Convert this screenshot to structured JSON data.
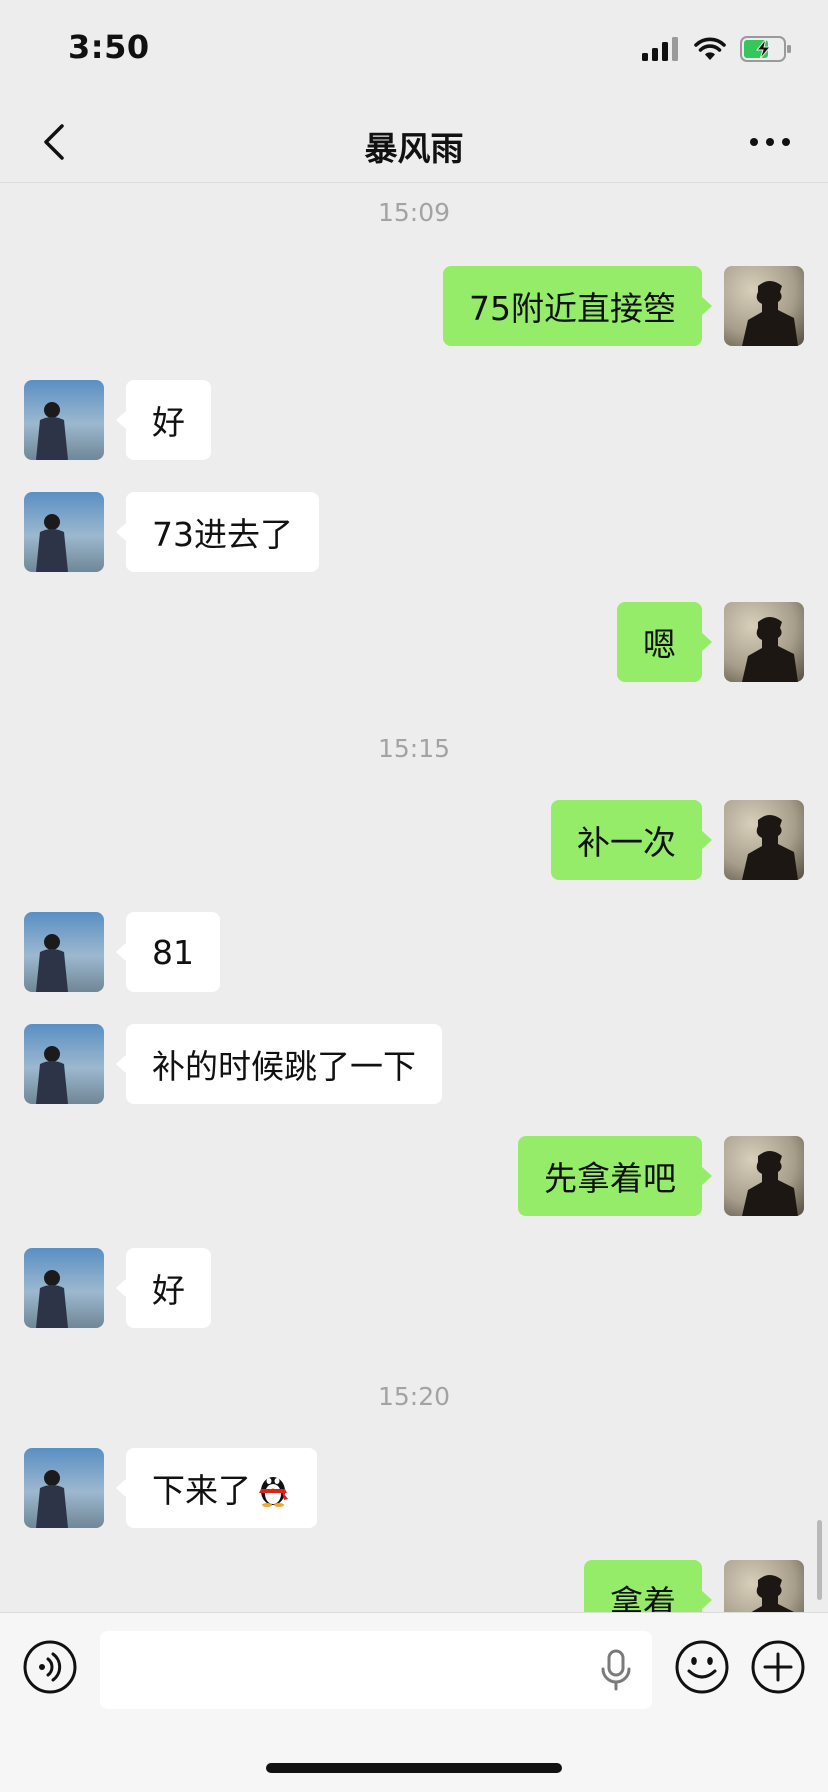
{
  "status_bar": {
    "time": "3:50"
  },
  "header": {
    "title": "暴风雨"
  },
  "chat": {
    "items": [
      {
        "kind": "time",
        "text": "15:09"
      },
      {
        "kind": "msg",
        "side": "out",
        "text": "75附近直接箜"
      },
      {
        "kind": "msg",
        "side": "in",
        "text": "好"
      },
      {
        "kind": "msg",
        "side": "in",
        "text": "73进去了"
      },
      {
        "kind": "msg",
        "side": "out",
        "text": "嗯"
      },
      {
        "kind": "time",
        "text": "15:15"
      },
      {
        "kind": "msg",
        "side": "out",
        "text": "补一次"
      },
      {
        "kind": "msg",
        "side": "in",
        "text": "81"
      },
      {
        "kind": "msg",
        "side": "in",
        "text": "补的时候跳了一下"
      },
      {
        "kind": "msg",
        "side": "out",
        "text": "先拿着吧"
      },
      {
        "kind": "msg",
        "side": "in",
        "text": "好"
      },
      {
        "kind": "time",
        "text": "15:20"
      },
      {
        "kind": "msg",
        "side": "in",
        "text": "下来了",
        "emoji": "penguin"
      },
      {
        "kind": "msg",
        "side": "out",
        "text": "拿着"
      }
    ]
  },
  "input_bar": {
    "placeholder": ""
  },
  "colors": {
    "outgoing_bubble": "#95ec69",
    "incoming_bubble": "#ffffff",
    "background": "#ededed"
  }
}
